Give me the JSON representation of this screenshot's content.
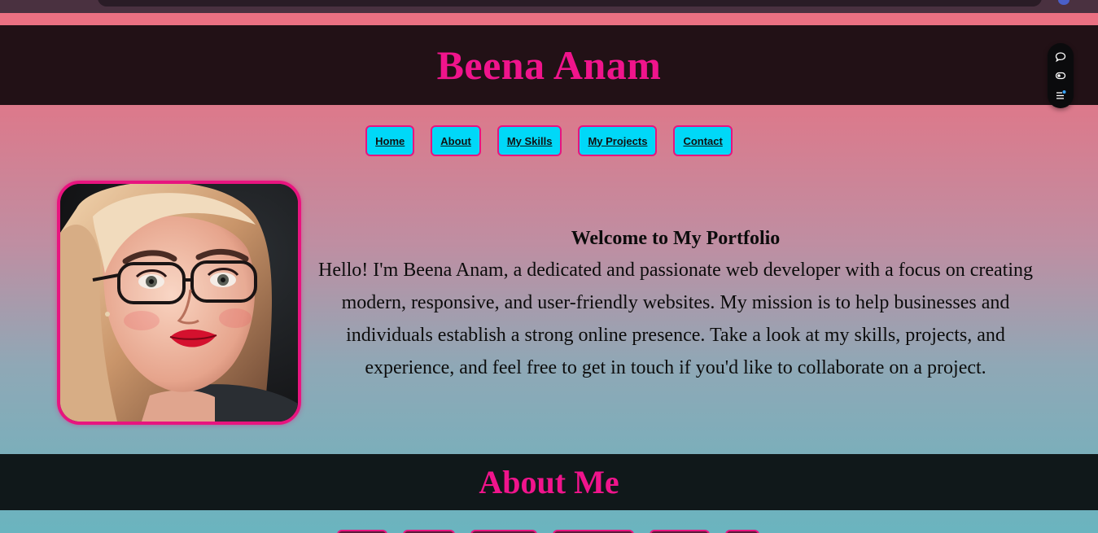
{
  "header": {
    "title": "Beena Anam"
  },
  "nav": {
    "items": [
      {
        "label": "Home"
      },
      {
        "label": "About"
      },
      {
        "label": "My Skills"
      },
      {
        "label": "My Projects"
      },
      {
        "label": "Contact"
      }
    ]
  },
  "intro": {
    "heading": "Welcome to My Portfolio",
    "body": "Hello! I'm Beena Anam, a dedicated and passionate web developer with a focus on creating modern, responsive, and user-friendly websites. My mission is to help businesses and individuals establish a strong online presence. Take a look at my skills, projects, and experience, and feel free to get in touch if you'd like to collaborate on a project."
  },
  "about": {
    "title": "About Me"
  },
  "side_toolbar": {
    "icons": [
      "chat-bubble-icon",
      "toggle-icon",
      "list-notification-icon"
    ]
  },
  "colors": {
    "accent_pink": "#f0148c",
    "nav_button_bg": "#00d8f8",
    "header_bg": "#221116",
    "about_bar_bg": "#10181a"
  }
}
